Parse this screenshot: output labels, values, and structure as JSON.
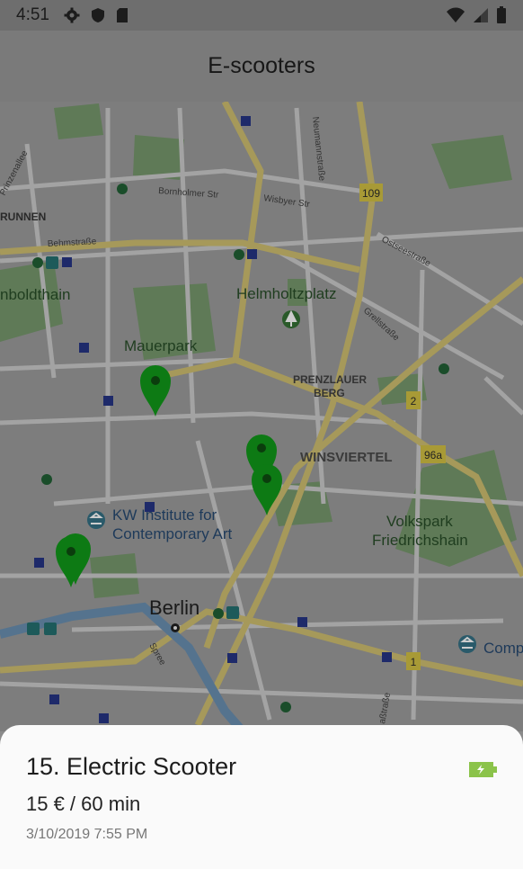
{
  "status_bar": {
    "time": "4:51",
    "left_icons": [
      "gear-icon",
      "shield-icon",
      "sd-card-icon"
    ],
    "right_icons": [
      "wifi-icon",
      "cell-signal-icon",
      "battery-icon"
    ]
  },
  "app_bar": {
    "title": "E-scooters"
  },
  "map": {
    "labels": {
      "prinzenallee": "Prinzenallee",
      "bornholmer": "Bornholmer Str",
      "wisbyer": "Wisbyer Str",
      "neumannstrasse": "Neumannstraße",
      "gesundbrunnen": "RUNNEN",
      "behmstrasse": "Behmstraße",
      "ostseestrasse": "Ostseestraße",
      "humboldthain": "nboldthain",
      "helmholtzplatz": "Helmholtzplatz",
      "grellstrasse": "Grellstraße",
      "mauerpark": "Mauerpark",
      "prenzlauer1": "PRENZLAUER",
      "prenzlauer2": "BERG",
      "winsviertel": "WINSVIERTEL",
      "kw1": "KW Institute for",
      "kw2": "Contemporary Art",
      "volkspark1": "Volkspark",
      "volkspark2": "Friedrichshain",
      "berlin": "Berlin",
      "spree": "Spree",
      "comp": "Comp",
      "strasse_bottom": "aßtraße"
    },
    "road_shields": [
      "109",
      "2",
      "96a",
      "1"
    ],
    "markers_count": 5
  },
  "detail": {
    "name": "15. Electric Scooter",
    "price": "15 € / 60 min",
    "date": "3/10/2019 7:55 PM",
    "battery_color": "#8bc34a"
  }
}
